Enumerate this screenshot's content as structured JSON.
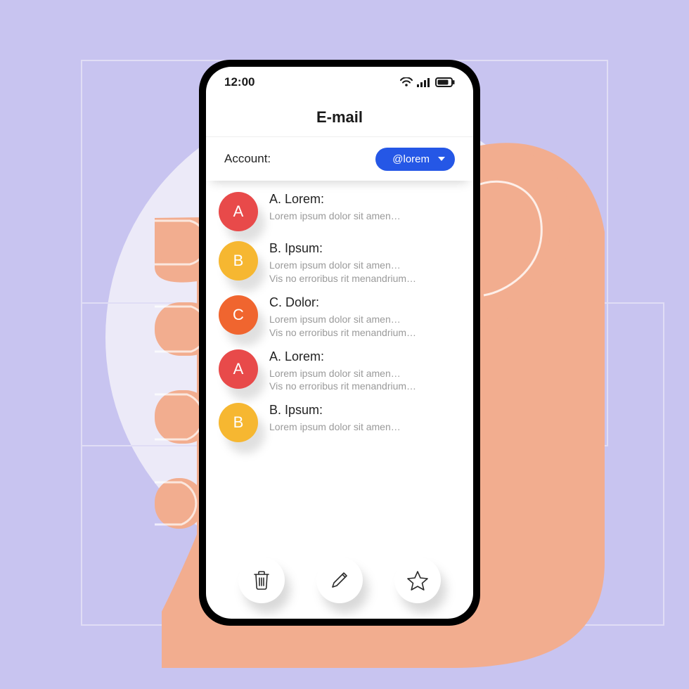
{
  "statusbar": {
    "time": "12:00"
  },
  "header": {
    "title": "E-mail"
  },
  "account": {
    "label": "Account:",
    "selected": "@lorem"
  },
  "avatar_colors": {
    "A": "#e84a4a",
    "B": "#f6b731",
    "C": "#f0652f"
  },
  "emails": [
    {
      "initial": "A",
      "sender": "A. Lorem:",
      "line1": "Lorem ipsum dolor sit amen…",
      "line2": ""
    },
    {
      "initial": "B",
      "sender": "B. Ipsum:",
      "line1": "Lorem ipsum dolor sit amen…",
      "line2": "Vis no erroribus rit menandrium…"
    },
    {
      "initial": "C",
      "sender": "C. Dolor:",
      "line1": "Lorem ipsum dolor sit amen…",
      "line2": "Vis no erroribus rit menandrium…"
    },
    {
      "initial": "A",
      "sender": "A. Lorem:",
      "line1": "Lorem ipsum dolor sit amen…",
      "line2": "Vis no erroribus rit menandrium…"
    },
    {
      "initial": "B",
      "sender": "B. Ipsum:",
      "line1": "Lorem ipsum dolor sit amen…",
      "line2": ""
    }
  ],
  "actions": {
    "delete": "trash-icon",
    "compose": "pencil-icon",
    "favorite": "star-icon"
  }
}
